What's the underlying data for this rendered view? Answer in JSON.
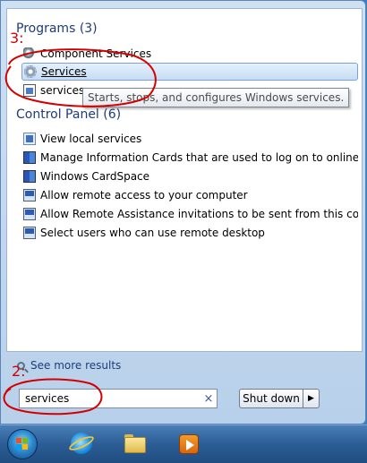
{
  "programs": {
    "header": "Programs (3)",
    "items": [
      {
        "label": "Component Services",
        "icon": "component-services-icon"
      },
      {
        "label": "Services",
        "icon": "gear-icon",
        "selected": true
      },
      {
        "label": "services",
        "icon": "window-icon"
      }
    ]
  },
  "tooltip": "Starts, stops, and configures Windows services.",
  "control_panel": {
    "header": "Control Panel (6)",
    "items": [
      {
        "label": "View local services",
        "icon": "control-panel-icon"
      },
      {
        "label": "Manage Information Cards that are used to log on to online ser...",
        "icon": "cardspace-icon"
      },
      {
        "label": "Windows CardSpace",
        "icon": "cardspace-icon"
      },
      {
        "label": "Allow remote access to your computer",
        "icon": "remote-icon"
      },
      {
        "label": "Allow Remote Assistance invitations to be sent from this comp...",
        "icon": "remote-icon"
      },
      {
        "label": "Select users who can use remote desktop",
        "icon": "remote-icon"
      }
    ]
  },
  "see_more": "See more results",
  "search": {
    "value": "services",
    "clear": "×"
  },
  "shutdown": {
    "label": "Shut down",
    "arrow": "▶"
  },
  "annotations": {
    "step3": "3:",
    "step2": "2:",
    "color": "#d40000"
  },
  "taskbar": {
    "icons": [
      "start-orb",
      "internet-explorer-icon",
      "windows-explorer-icon",
      "media-player-icon"
    ]
  }
}
